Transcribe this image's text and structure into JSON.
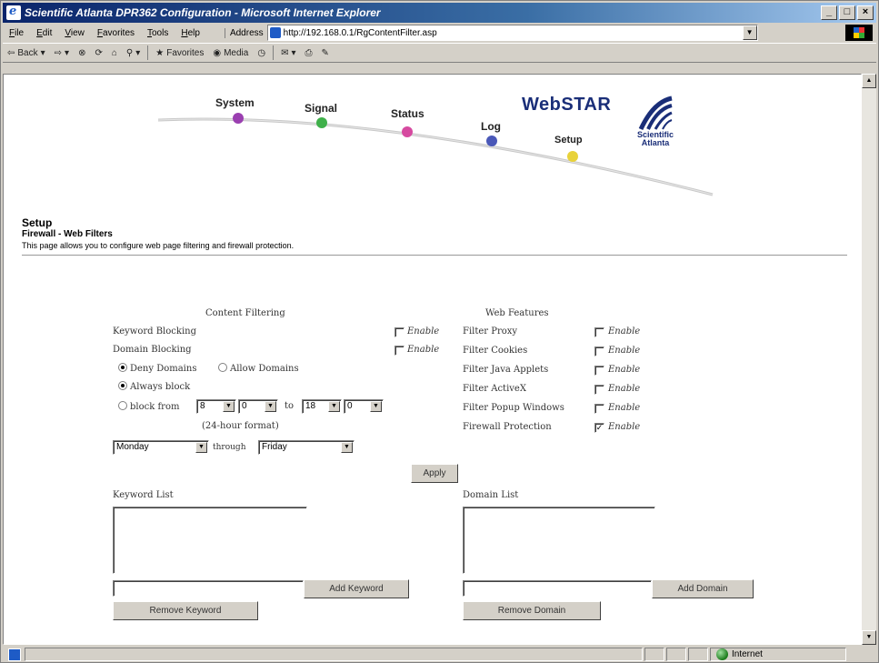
{
  "window": {
    "title": "Scientific Atlanta DPR362 Configuration - Microsoft Internet Explorer",
    "controls": [
      "_",
      "□",
      "×"
    ]
  },
  "menubar": {
    "items": [
      "File",
      "Edit",
      "View",
      "Favorites",
      "Tools",
      "Help"
    ],
    "address_label": "Address",
    "address_url": "http://192.168.0.1/RgContentFilter.asp"
  },
  "toolbar": {
    "back": "Back",
    "favorites": "Favorites",
    "media": "Media"
  },
  "banner": {
    "nav": [
      "System",
      "Signal",
      "Status",
      "Log",
      "Setup"
    ],
    "product": "WebSTAR",
    "company_line1": "Scientific",
    "company_line2": "Atlanta"
  },
  "page": {
    "setup_title": "Setup",
    "section_title": "Firewall - Web Filters",
    "description": "This page allows you to configure web page filtering and firewall protection."
  },
  "content_filtering": {
    "heading": "Content Filtering",
    "keyword_blocking": "Keyword Blocking",
    "domain_blocking": "Domain Blocking",
    "enable": "Enable",
    "keyword_enabled": false,
    "domain_enabled": false,
    "deny_domains": "Deny Domains",
    "allow_domains": "Allow Domains",
    "always_block": "Always block",
    "block_from": "block from",
    "from_hour": "8",
    "from_min": "0",
    "to_label": "to",
    "to_hour": "18",
    "to_min": "0",
    "hour_format": "(24-hour format)",
    "day_from": "Monday",
    "through": "through",
    "day_to": "Friday"
  },
  "web_features": {
    "heading": "Web Features",
    "enable": "Enable",
    "items": [
      {
        "label": "Filter Proxy",
        "checked": false
      },
      {
        "label": "Filter Cookies",
        "checked": false
      },
      {
        "label": "Filter Java Applets",
        "checked": false
      },
      {
        "label": "Filter ActiveX",
        "checked": false
      },
      {
        "label": "Filter Popup Windows",
        "checked": false
      },
      {
        "label": "Firewall Protection",
        "checked": true
      }
    ]
  },
  "apply_label": "Apply",
  "keyword_list": {
    "label": "Keyword List",
    "add_label": "Add Keyword",
    "remove_label": "Remove Keyword",
    "input_value": ""
  },
  "domain_list": {
    "label": "Domain List",
    "add_label": "Add Domain",
    "remove_label": "Remove Domain",
    "input_value": ""
  },
  "statusbar": {
    "zone": "Internet"
  }
}
